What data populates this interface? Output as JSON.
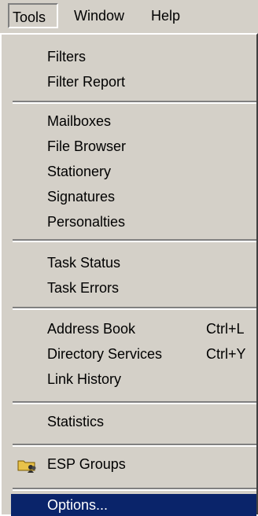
{
  "menubar": [
    {
      "label": "Tools",
      "accel": "T"
    },
    {
      "label": "Window",
      "accel": "W"
    },
    {
      "label": "Help",
      "accel": "H"
    }
  ],
  "menu": {
    "groups": [
      [
        "Filters",
        "Filter Report"
      ],
      [
        "Mailboxes",
        "File Browser",
        "Stationery",
        "Signatures",
        "Personalties"
      ],
      [
        "Task Status",
        "Task Errors"
      ],
      [
        "Address Book",
        "Directory Services",
        "Link History"
      ],
      [
        "Statistics"
      ],
      [
        "ESP Groups"
      ],
      [
        "Options..."
      ]
    ],
    "items": {
      "filters": {
        "label": "Filters"
      },
      "filter_report": {
        "label": "Filter Report"
      },
      "mailboxes": {
        "label": "Mailboxes"
      },
      "file_browser": {
        "label": "File Browser"
      },
      "stationery": {
        "label": "Stationery"
      },
      "signatures": {
        "label": "Signatures"
      },
      "personalties": {
        "label": "Personalties"
      },
      "task_status": {
        "label": "Task Status"
      },
      "task_errors": {
        "label": "Task Errors"
      },
      "address_book": {
        "label": "Address Book",
        "shortcut": "Ctrl+L"
      },
      "directory_services": {
        "label": "Directory Services",
        "shortcut": "Ctrl+Y"
      },
      "link_history": {
        "label": "Link History"
      },
      "statistics": {
        "label": "Statistics"
      },
      "esp_groups": {
        "label": "ESP Groups",
        "icon": "folder-group-icon"
      },
      "options": {
        "label": "Options...",
        "state": "highlighted"
      }
    }
  },
  "colors": {
    "menu_face": "#d4d0c8",
    "highlight": "#0a246a",
    "highlight_text": "#ffffff",
    "separator_dark": "#808080",
    "separator_light": "#ffffff"
  }
}
